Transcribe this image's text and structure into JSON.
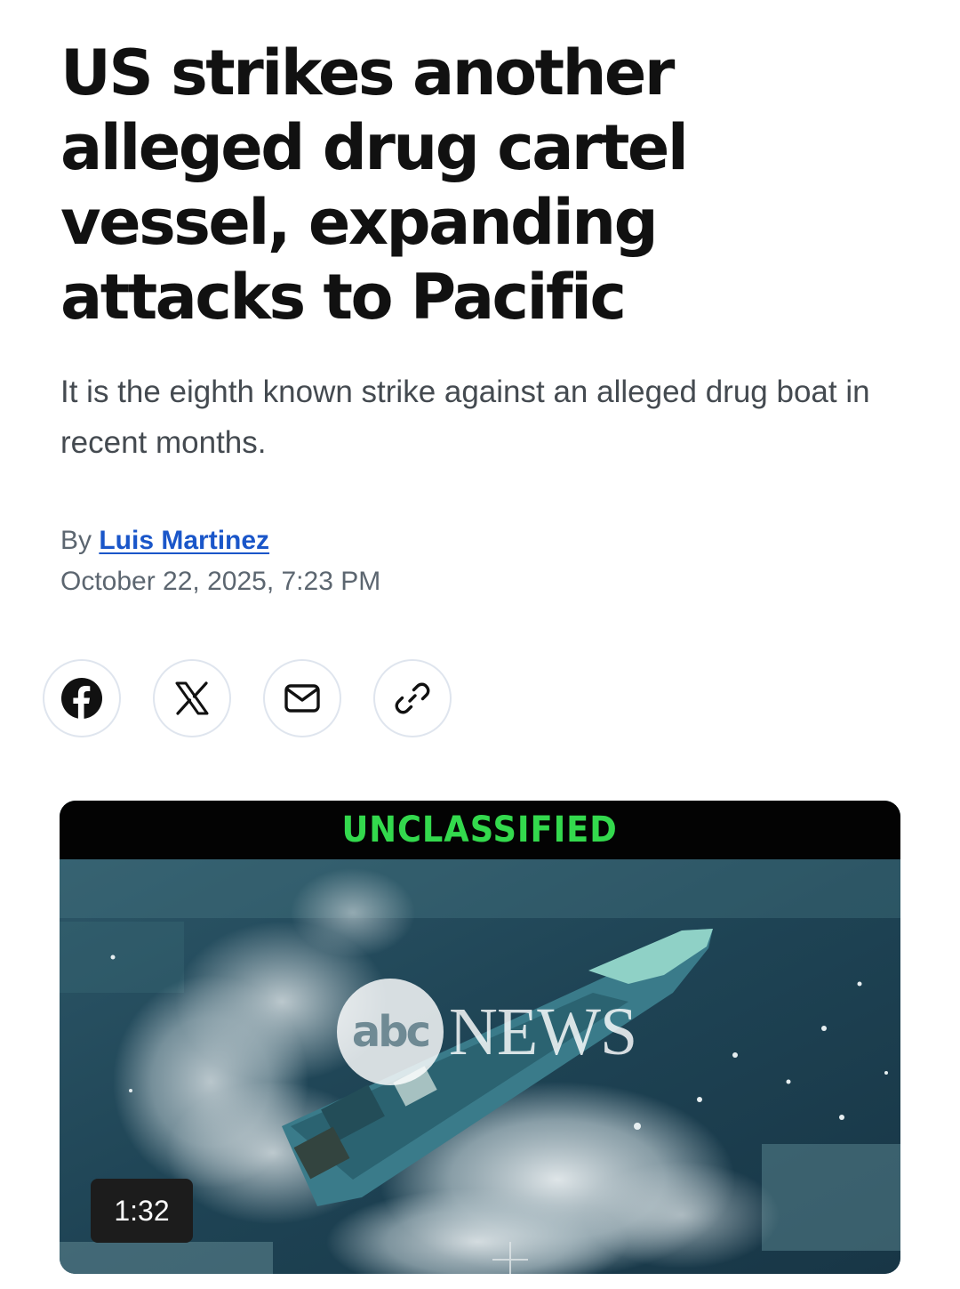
{
  "article": {
    "headline": "US strikes another alleged drug cartel vessel, expanding attacks to Pacific",
    "subheadline": "It is the eighth known strike against an alleged drug boat in recent months.",
    "byline_prefix": "By",
    "author": "Luis Martinez",
    "date": "October 22, 2025, 7:23 PM"
  },
  "share": {
    "buttons": [
      {
        "name": "facebook",
        "icon": "facebook-icon"
      },
      {
        "name": "x",
        "icon": "x-icon"
      },
      {
        "name": "email",
        "icon": "mail-icon"
      },
      {
        "name": "copy-link",
        "icon": "link-icon"
      }
    ]
  },
  "video": {
    "banner": "UNCLASSIFIED",
    "watermark_abc": "abc",
    "watermark_news": "NEWS",
    "duration": "1:32"
  },
  "colors": {
    "author_link": "#1a56c9",
    "banner_text": "#33d94d",
    "muted_text": "#5c6670"
  }
}
